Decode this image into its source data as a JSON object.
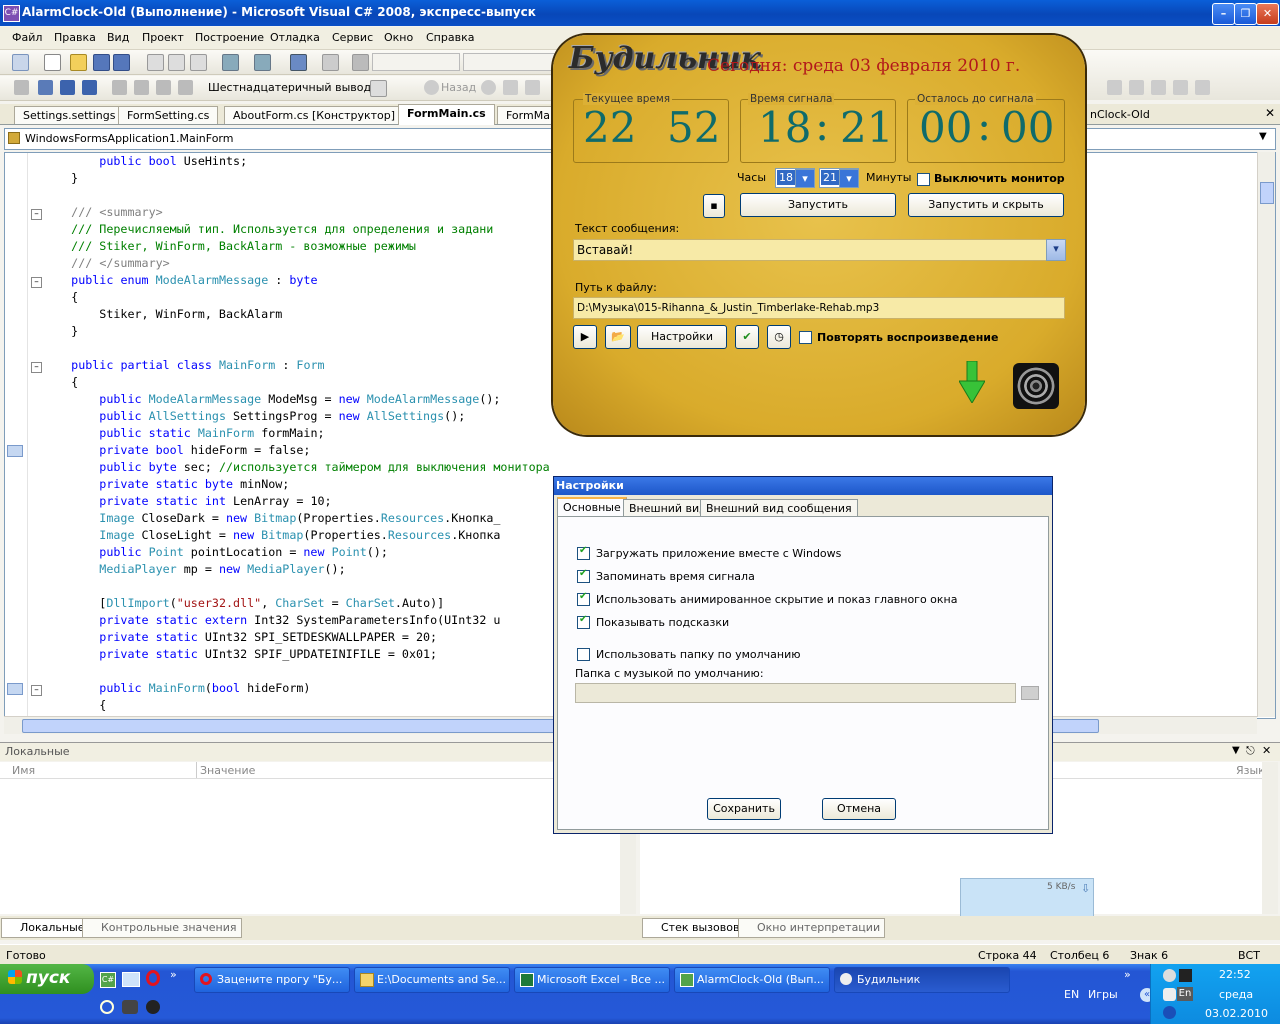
{
  "window": {
    "title": "AlarmClock-Old (Выполнение) - Microsoft Visual C# 2008, экспресс-выпуск",
    "app_icon": "C#"
  },
  "menu": [
    "Файл",
    "Правка",
    "Вид",
    "Проект",
    "Построение",
    "Отладка",
    "Сервис",
    "Окно",
    "Справка"
  ],
  "toolbar2": {
    "hex_output": "Шестнадцатеричный вывод",
    "back": "Назад"
  },
  "tabs": [
    "Settings.settings",
    "FormSetting.cs",
    "AboutForm.cs [Конструктор]",
    "FormMain.cs",
    "FormMain",
    "nClock-Old"
  ],
  "navbar": {
    "class_path": "WindowsFormsApplication1.MainForm"
  },
  "code": [
    "        public bool UseHints;",
    "    }",
    "",
    "    /// <summary>",
    "    /// Перечисляемый тип. Используется для определения и задани",
    "    /// Stiker, WinForm, BackAlarm - возможные режимы",
    "    /// </summary>",
    "    public enum ModeAlarmMessage : byte",
    "    {",
    "        Stiker, WinForm, BackAlarm",
    "    }",
    "",
    "    public partial class MainForm : Form",
    "    {",
    "        public ModeAlarmMessage ModeMsg = new ModeAlarmMessage();",
    "        public AllSettings SettingsProg = new AllSettings();",
    "        public static MainForm formMain;",
    "        private bool hideForm = false;",
    "        public byte sec; //используется таймером для выключения монитора",
    "        private static byte minNow;",
    "        private static int LenArray = 10;",
    "        Image CloseDark = new Bitmap(Properties.Resources.Кнопка_",
    "        Image CloseLight = new Bitmap(Properties.Resources.Кнопка",
    "        public Point pointLocation = new Point();",
    "        MediaPlayer mp = new MediaPlayer();",
    "",
    "        [DllImport(\"user32.dll\", CharSet = CharSet.Auto)]",
    "        private static extern Int32 SystemParametersInfo(UInt32 u",
    "        private static UInt32 SPI_SETDESKWALLPAPER = 20;",
    "        private static UInt32 SPIF_UPDATEINIFILE = 0x01;",
    "",
    "        public MainForm(bool hideForm)",
    "        {"
  ],
  "locals": {
    "title": "Локальные",
    "col_name": "Имя",
    "col_value": "Значение",
    "tab_locals": "Локальные",
    "tab_watch": "Контрольные значения"
  },
  "right_panel": {
    "col_lang": "Язык",
    "tab_callstack": "Стек вызовов",
    "tab_immediate": "Окно интерпретации",
    "speed": "5 KB/s"
  },
  "status": {
    "ready": "Готово",
    "line": "Строка 44",
    "col": "Столбец 6",
    "char": "Знак 6",
    "ins": "ВСТ"
  },
  "taskbar": {
    "start": "пуск",
    "buttons": [
      "Зацените прогу \"Бу...",
      "E:\\Documents and Se...",
      "Microsoft Excel - Все ...",
      "AlarmClock-Old (Вып...",
      "Будильник"
    ],
    "lang": "EN",
    "games": "Игры",
    "en_icon": "En",
    "time": "22:52",
    "day": "среда",
    "date": "03.02.2010"
  },
  "alarm": {
    "logo": "Будильник",
    "today": "Сегодня: среда 03 февраля 2010 г.",
    "current_time_label": "Текущее время",
    "current_hours": "22",
    "current_minutes": "52",
    "alarm_time_label": "Время сигнала",
    "alarm_hours": "18",
    "alarm_minutes": "21",
    "remaining_label": "Осталось до сигнала",
    "remaining_hours": "00",
    "remaining_minutes": "00",
    "hours_label": "Часы",
    "hours_value": "18",
    "minutes_label": "Минуты",
    "minutes_value": "21",
    "monitor_off": "Выключить монитор",
    "start": "Запустить",
    "start_hide": "Запустить и скрыть",
    "message_label": "Текст сообщения:",
    "message_value": "Вставай!",
    "file_label": "Путь к файлу:",
    "file_value": "D:\\Музыка\\015-Rihanna_&_Justin_Timberlake-Rehab.mp3",
    "settings": "Настройки",
    "repeat": "Повторять воспроизведение"
  },
  "settings_dialog": {
    "title": "Настройки",
    "tabs": [
      "Основные",
      "Внешний вид",
      "Внешний вид сообщения"
    ],
    "options": [
      {
        "label": "Загружать приложение вместе с Windows",
        "checked": true
      },
      {
        "label": "Запоминать время сигнала",
        "checked": true
      },
      {
        "label": "Использовать анимированное скрытие и показ главного окна",
        "checked": true
      },
      {
        "label": "Показывать подсказки",
        "checked": true
      },
      {
        "label": "Использовать папку по умолчанию",
        "checked": false
      }
    ],
    "folder_label": "Папка с музыкой по умолчанию:",
    "save": "Сохранить",
    "cancel": "Отмена"
  }
}
